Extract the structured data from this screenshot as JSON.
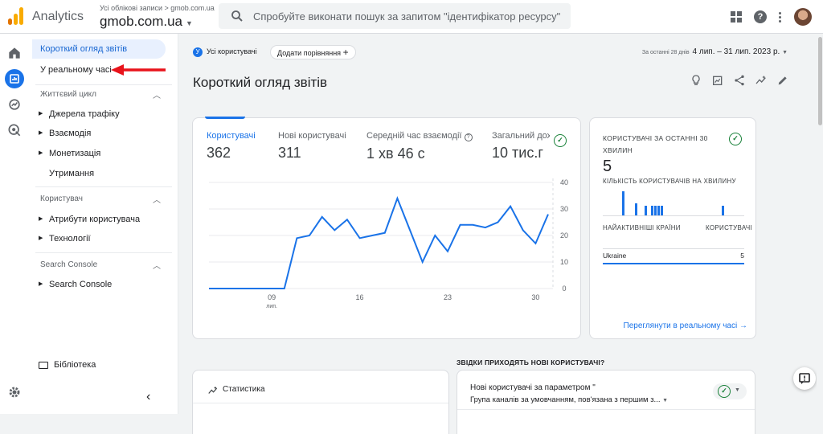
{
  "header": {
    "app_name": "Analytics",
    "account_crumb": "Усі облікові записи > gmob.com.ua",
    "property": "gmob.com.ua",
    "search_placeholder": "Спробуйте виконати пошук за запитом \"ідентифікатор ресурсу\"",
    "icons": [
      "apps-grid-icon",
      "help-icon",
      "more-vert-icon",
      "avatar"
    ]
  },
  "rail": {
    "icons": [
      "home-icon",
      "reports-icon",
      "explore-icon",
      "advertising-icon",
      "settings-icon"
    ]
  },
  "nav": {
    "reports_snapshot": "Короткий огляд звітів",
    "realtime": "У реальному часі",
    "lifecycle_label": "Життєвий цикл",
    "lifecycle_items": [
      "Джерела трафіку",
      "Взаємодія",
      "Монетизація",
      "Утримання"
    ],
    "user_label": "Користувач",
    "user_items": [
      "Атрибути користувача",
      "Технології"
    ],
    "search_console_label": "Search Console",
    "search_console_items": [
      "Search Console"
    ],
    "library": "Бібліотека"
  },
  "toolbar": {
    "segment_badge": "У",
    "segment_chip": "Усі користувачі",
    "add_comparison": "Додати порівняння",
    "date_prefix": "За останні 28 днів",
    "date_range": "4 лип. – 31 лип. 2023 р."
  },
  "page": {
    "title": "Короткий огляд звітів"
  },
  "overview": {
    "metrics": [
      {
        "label": "Користувачі",
        "value": "362"
      },
      {
        "label": "Нові користувачі",
        "value": "311"
      },
      {
        "label": "Середній час взаємодії",
        "value": "1 хв 46 с"
      },
      {
        "label": "Загальний дохі,",
        "value": "10 тис.г"
      }
    ]
  },
  "chart_data": {
    "type": "line",
    "series": [
      {
        "values": [
          0,
          0,
          0,
          0,
          0,
          0,
          0,
          19,
          20,
          27,
          22,
          26,
          19,
          20,
          21,
          34,
          22,
          10,
          20,
          14,
          24,
          24,
          23,
          25,
          31,
          22,
          17,
          28
        ]
      }
    ],
    "x_ticks": [
      "09",
      "16",
      "23",
      "30"
    ],
    "x_tick_sub": "лип.",
    "y_ticks": [
      "40",
      "30",
      "20",
      "10",
      "0"
    ],
    "ylim": [
      0,
      40
    ],
    "grid": true,
    "color": "#1a73e8"
  },
  "realtime": {
    "title": "КОРИСТУВАЧІ ЗА ОСТАННІ 30 ХВИЛИН",
    "count": "5",
    "per_minute_label": "КІЛЬКІСТЬ КОРИСТУВАЧІВ НА ХВИЛИНУ",
    "per_minute_bars": [
      0,
      0,
      0,
      0,
      0,
      0,
      1,
      0,
      0,
      0,
      0.5,
      0,
      0,
      0.4,
      0,
      0.4,
      0.4,
      0.4,
      0.4,
      0,
      0,
      0,
      0,
      0,
      0,
      0,
      0,
      0,
      0,
      0,
      0,
      0,
      0,
      0,
      0,
      0,
      0,
      0.4,
      0,
      0,
      0,
      0,
      0,
      0
    ],
    "col_countries": "НАЙАКТИВНІШІ КРАЇНИ",
    "col_users": "КОРИСТУВАЧІ",
    "rows": [
      {
        "country": "Ukraine",
        "users": "5"
      }
    ],
    "link": "Переглянути в реальному часі"
  },
  "lower": {
    "stats_title": "Статистика",
    "sources_question": "ЗВІДКИ ПРИХОДЯТЬ НОВІ КОРИСТУВАЧІ?",
    "sources_title": "Нові користувачі за параметром \"",
    "sources_dimension": "Група каналів за умовчанням, пов'язана з першим з..."
  },
  "colors": {
    "accent": "#1a73e8",
    "active_bg": "#e8f0fe",
    "check": "#188038",
    "arrow": "#e8131b"
  }
}
